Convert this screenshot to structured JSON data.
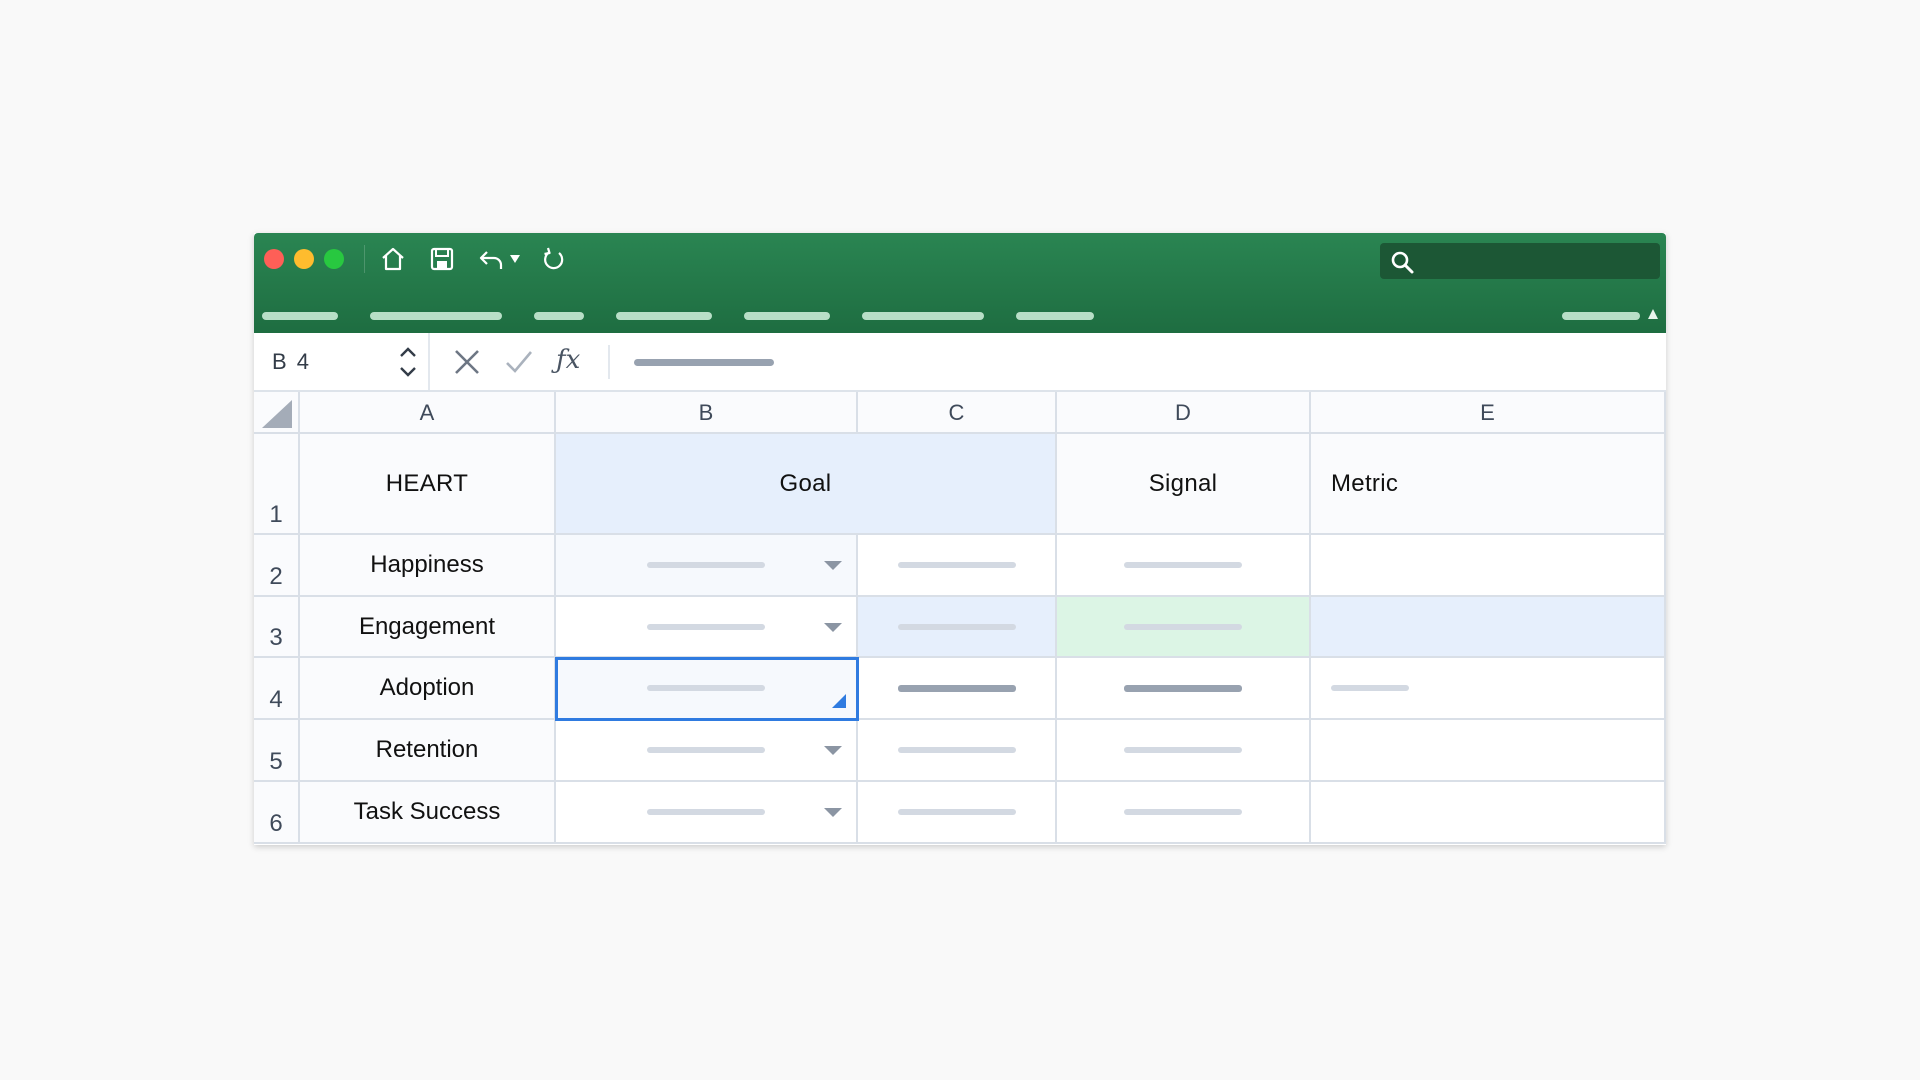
{
  "toolbar": {
    "icons": [
      "home-icon",
      "save-icon",
      "undo-icon",
      "dropdown-caret-icon",
      "redo-icon"
    ],
    "search_icon": "search-icon"
  },
  "formula_bar": {
    "name_box": "B 4",
    "cancel_icon": "close-icon",
    "confirm_icon": "check-icon",
    "fx_label": "ƒx"
  },
  "sheet": {
    "columns": [
      "A",
      "B",
      "C",
      "D",
      "E"
    ],
    "rows": [
      "1",
      "2",
      "3",
      "4",
      "5",
      "6"
    ],
    "header_row": {
      "a": "HEART",
      "b": "Goal",
      "d": "Signal",
      "e": "Metric"
    },
    "categories": [
      "Happiness",
      "Engagement",
      "Adoption",
      "Retention",
      "Task Success"
    ],
    "selected_cell": "B4"
  },
  "colors": {
    "titlebar": "#2a8552",
    "selection": "#2f7be0",
    "highlight_blue": "#e6effc",
    "highlight_green": "#dcf5e5"
  }
}
